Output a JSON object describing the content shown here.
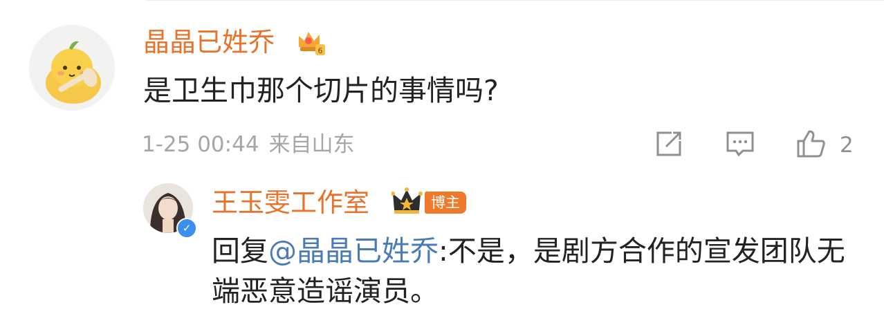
{
  "comment": {
    "username": "晶晶已姓乔",
    "text": "是卫生巾那个切片的事情吗?",
    "date": "1-25 00:44",
    "location": "来自山东",
    "like_count": "2"
  },
  "reply": {
    "username": "王玉雯工作室",
    "role_badge": "博主",
    "prefix": "回复",
    "mention": "@晶晶已姓乔",
    "text": ":不是，是剧方合作的宣发团队无端恶意造谣演员。"
  },
  "icons": {
    "share": "share-icon",
    "comment": "comment-icon",
    "like": "like-icon",
    "badge": "vip-badge-icon",
    "crown": "crown-icon",
    "verified": "verified-icon"
  },
  "colors": {
    "username": "#e8722b",
    "mention": "#4a7bb7",
    "meta": "#a6a6a6",
    "verified": "#3c8ff0",
    "role_badge": "#f07a2c"
  }
}
